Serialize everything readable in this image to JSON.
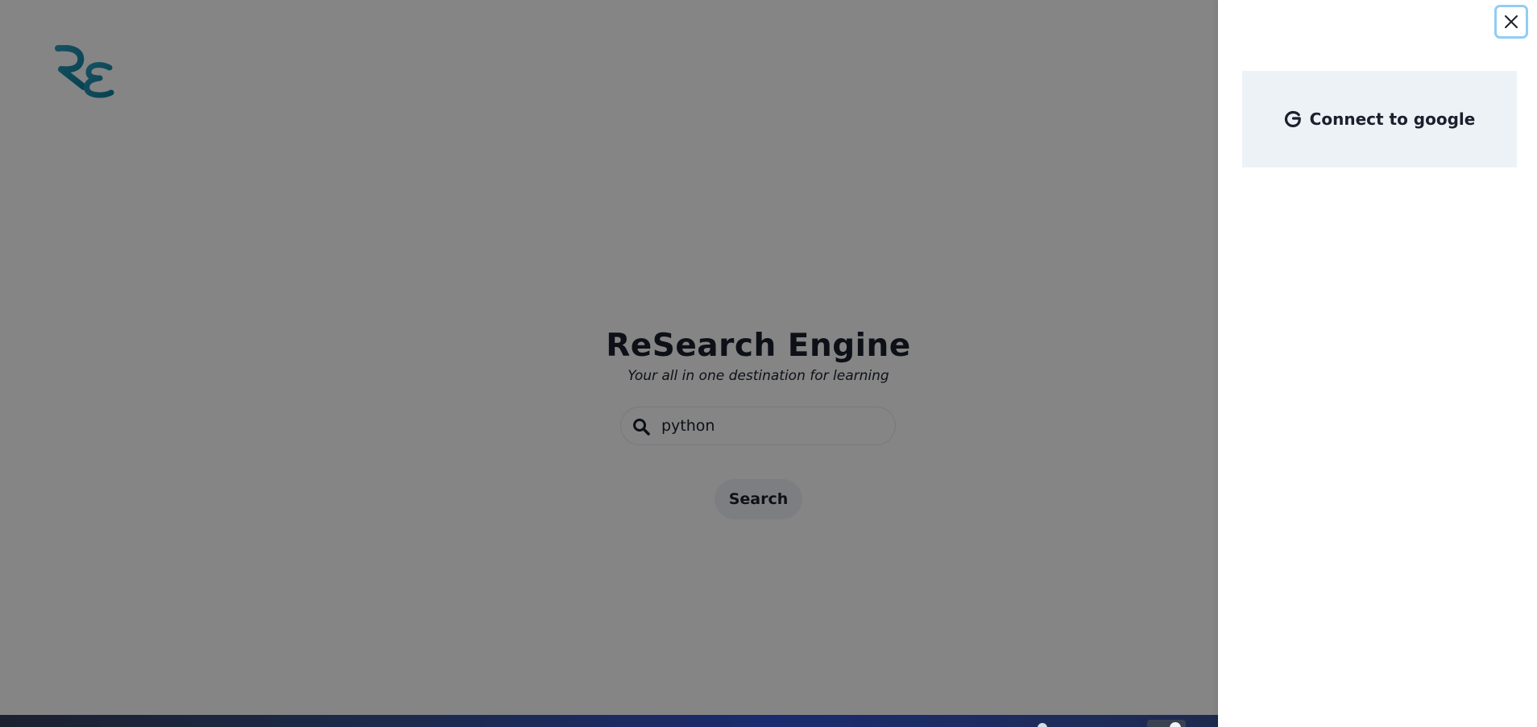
{
  "app": {
    "logo_text": "RE"
  },
  "hero": {
    "title": "ReSearch Engine",
    "subtitle": "Your all in one destination for learning"
  },
  "search": {
    "value": "python",
    "button_label": "Search"
  },
  "drawer": {
    "connect_label": "Connect to google"
  },
  "icons": {
    "search": "search-icon",
    "close": "close-icon",
    "google": "google-icon"
  },
  "colors": {
    "logo": "#1c8eae",
    "text": "#1a202c",
    "button_bg": "#edf2f7",
    "focus_ring": "#90cdf4"
  }
}
